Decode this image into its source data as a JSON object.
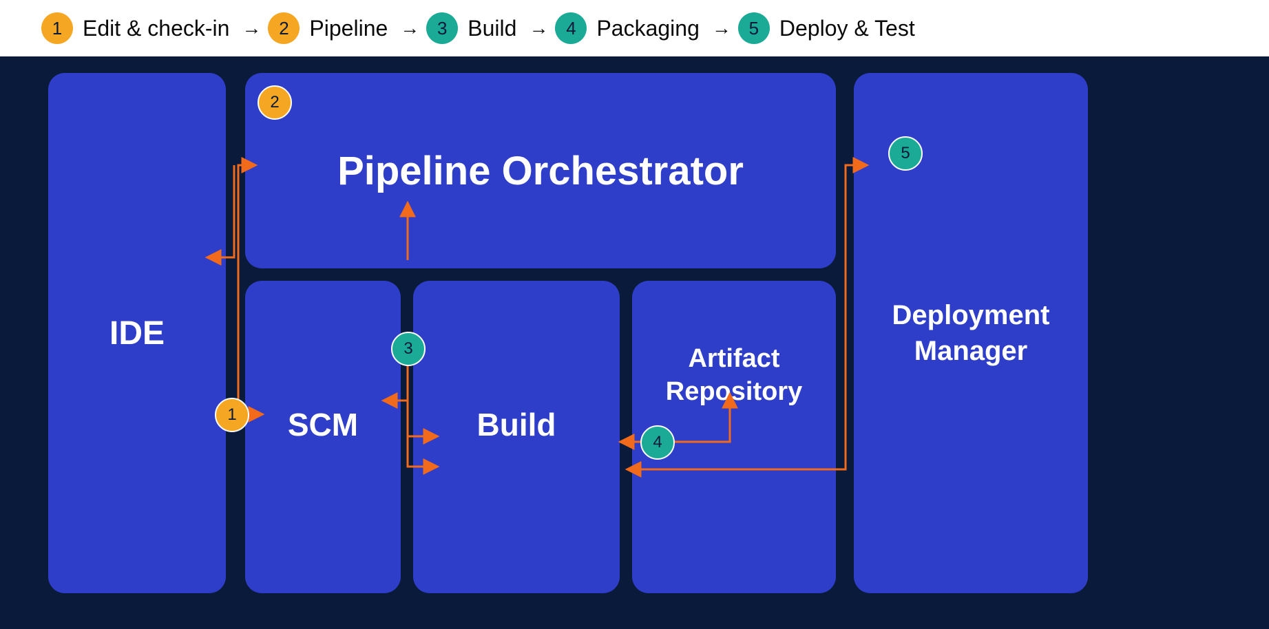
{
  "legend": {
    "items": [
      {
        "num": "1",
        "color": "orange",
        "label": "Edit & check-in"
      },
      {
        "num": "2",
        "color": "orange",
        "label": "Pipeline"
      },
      {
        "num": "3",
        "color": "teal",
        "label": "Build"
      },
      {
        "num": "4",
        "color": "teal",
        "label": "Packaging"
      },
      {
        "num": "5",
        "color": "teal",
        "label": "Deploy & Test"
      }
    ]
  },
  "boxes": {
    "ide": "IDE",
    "pipeline_orchestrator": "Pipeline Orchestrator",
    "scm": "SCM",
    "build": "Build",
    "artifact_repository_line1": "Artifact",
    "artifact_repository_line2": "Repository",
    "deployment_manager_line1": "Deployment",
    "deployment_manager_line2": "Manager"
  },
  "flow_badges": {
    "b1": "1",
    "b2": "2",
    "b3": "3",
    "b4": "4",
    "b5": "5"
  },
  "colors": {
    "orange": "#f5a623",
    "teal": "#1baa96",
    "box": "#2e3ec8",
    "stage_bg": "#0a1a3a",
    "flow": "#f26a1b"
  }
}
